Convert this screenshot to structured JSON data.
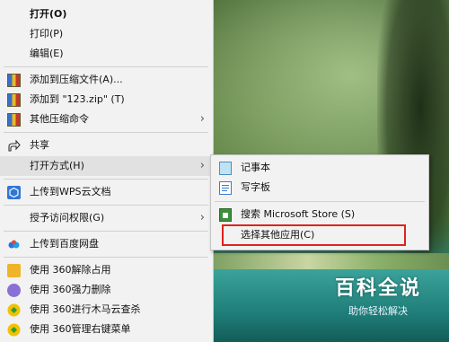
{
  "context_menu": {
    "items": [
      {
        "label": "打开(O)",
        "icon": "none"
      },
      {
        "label": "打印(P)",
        "icon": "none"
      },
      {
        "label": "编辑(E)",
        "icon": "none"
      },
      {
        "label": "添加到压缩文件(A)...",
        "icon": "archive-icon"
      },
      {
        "label": "添加到 \"123.zip\" (T)",
        "icon": "archive-icon"
      },
      {
        "label": "其他压缩命令",
        "icon": "archive-icon",
        "submenu_arrow": "›"
      },
      {
        "label": "共享",
        "icon": "share-icon"
      },
      {
        "label": "打开方式(H)",
        "icon": "none",
        "submenu_arrow": "›"
      },
      {
        "label": "上传到WPS云文档",
        "icon": "wps-cloud-icon"
      },
      {
        "label": "授予访问权限(G)",
        "icon": "none",
        "submenu_arrow": "›"
      },
      {
        "label": "上传到百度网盘",
        "icon": "baidu-netdisk-icon"
      },
      {
        "label": "使用 360解除占用",
        "icon": "360-unlock-icon"
      },
      {
        "label": "使用 360强力删除",
        "icon": "360-delete-icon"
      },
      {
        "label": "使用 360进行木马云查杀",
        "icon": "360-scan-icon"
      },
      {
        "label": "使用 360管理右键菜单",
        "icon": "360-menu-icon"
      }
    ]
  },
  "open_with_submenu": {
    "items": [
      {
        "label": "记事本",
        "icon": "notepad-icon"
      },
      {
        "label": "写字板",
        "icon": "wordpad-icon"
      },
      {
        "label": "搜索 Microsoft Store (S)",
        "icon": "store-icon"
      },
      {
        "label": "选择其他应用(C)",
        "icon": "none"
      }
    ]
  },
  "watermark": {
    "title": "百科全说",
    "subtitle": "助你轻松解决"
  },
  "colors": {
    "menu_bg": "#f2f2f2",
    "highlight_bg": "#e1e1e1",
    "annotation_red": "#e0221c"
  }
}
